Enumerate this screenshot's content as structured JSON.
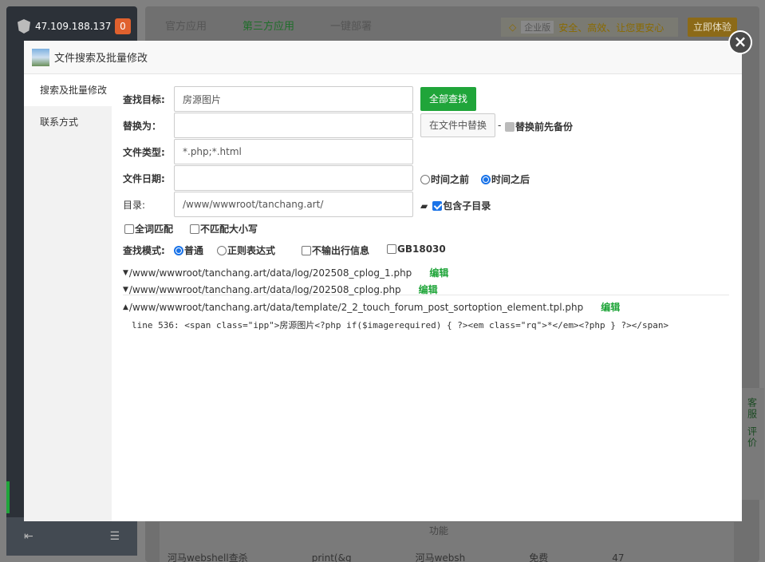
{
  "background": {
    "server_ip": "47.109.188.137",
    "badge_count": "0",
    "tabs": [
      "官方应用",
      "第三方应用",
      "一键部署"
    ],
    "promo_edition": "企业版",
    "promo_text": "安全、高效、让您更安心",
    "try_button": "立即体验",
    "right_rail": [
      "客服",
      "评价"
    ],
    "table_partial_row1": "功能",
    "table_partial_row2": {
      "name": "河马webshell查杀",
      "col2": "print(&g",
      "col3": "河马websh",
      "col4": "免费",
      "col5": "47"
    },
    "sidebar_bottom_icons": [
      "indent-icon",
      "list-icon"
    ]
  },
  "modal": {
    "title": "文件搜索及批量修改",
    "close_symbol": "×",
    "side_menu": [
      {
        "label": "搜索及批量修改",
        "active": true
      },
      {
        "label": "联系方式",
        "active": false
      }
    ],
    "form": {
      "target_label": "查找目标:",
      "target_value": "房源图片",
      "find_all_button": "全部查找",
      "replace_label": "替换为：",
      "replace_value": "",
      "replace_button": "在文件中替换",
      "replace_dash": "-",
      "backup_label": "替换前先备份",
      "filetype_label": "文件类型:",
      "filetype_value": "*.php;*.html",
      "date_label": "文件日期:",
      "date_value": "",
      "time_before": "时间之前",
      "time_after": "时间之后",
      "dir_label": "目录:",
      "dir_value": "/www/wwwroot/tanchang.art/",
      "include_subdir": "包含子目录",
      "whole_word": "全词匹配",
      "ignore_case": "不匹配大小写",
      "mode_label": "查找模式:",
      "mode_normal": "普通",
      "mode_regex": "正则表达式",
      "no_output_line": "不输出行信息",
      "gb18030": "GB18030"
    },
    "results": [
      {
        "expanded": false,
        "path": "/www/wwwroot/tanchang.art/data/log/202508_cplog_1.php",
        "edit": "编辑"
      },
      {
        "expanded": false,
        "path": "/www/wwwroot/tanchang.art/data/log/202508_cplog.php",
        "edit": "编辑"
      },
      {
        "expanded": true,
        "path": "/www/wwwroot/tanchang.art/data/template/2_2_touch_forum_post_sortoption_element.tpl.php",
        "edit": "编辑"
      }
    ],
    "code_line": "line 536: <span class=\"ipp\">房源图片<?php if($imagerequired) { ?><em class=\"rq\">*</em><?php } ?></span>"
  }
}
